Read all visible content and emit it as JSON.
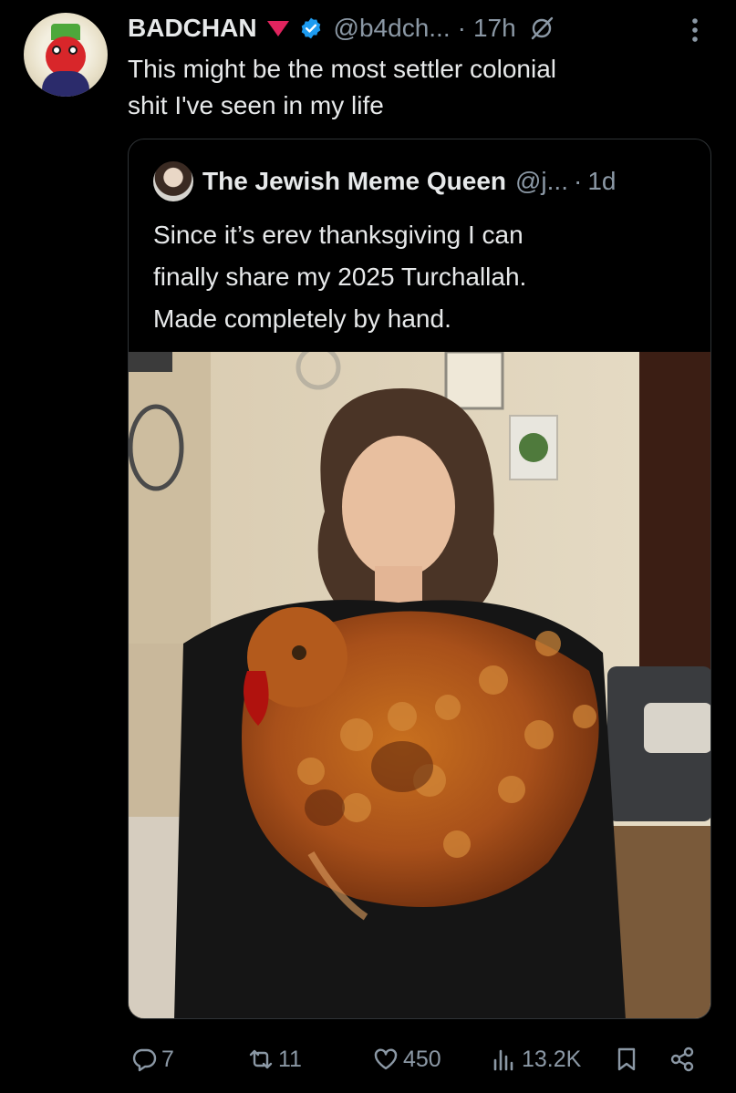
{
  "post": {
    "author_name": "BADCHAN",
    "handle": "@b4dch...",
    "time": "17h",
    "separator": "·",
    "text_line1": "This might be the most settler colonial",
    "text_line2": "shit I've seen in my life"
  },
  "quote": {
    "author_name": "The Jewish Meme Queen",
    "handle": "@j...",
    "time": "1d",
    "separator": "·",
    "text_line1": "Since it’s erev thanksgiving I can",
    "text_line2": "finally share my 2025 Turchallah.",
    "text_line3": "Made completely by hand."
  },
  "actions": {
    "replies": "7",
    "reposts": "11",
    "likes": "450",
    "views": "13.2K"
  },
  "colors": {
    "background": "#000000",
    "text": "#e7e9ea",
    "secondary": "#8b98a5",
    "verified": "#1d9bf0",
    "border": "#2f3336"
  },
  "icons": [
    "red-triangle-flag-icon",
    "verified-badge-icon",
    "grok-icon",
    "more-icon",
    "reply-icon",
    "repost-icon",
    "like-icon",
    "views-icon",
    "bookmark-icon",
    "share-icon"
  ]
}
